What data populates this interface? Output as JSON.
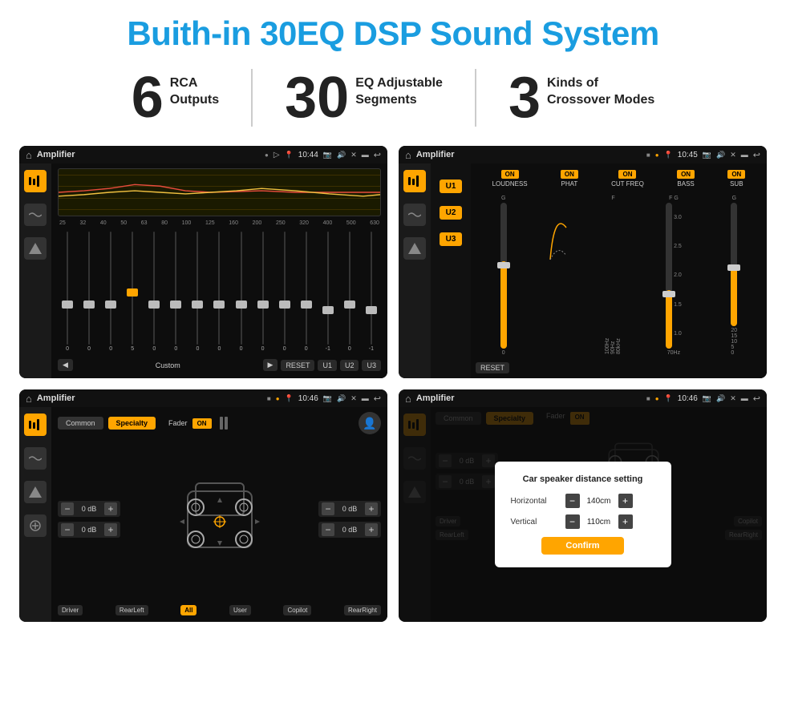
{
  "page": {
    "title": "Buith-in 30EQ DSP Sound System",
    "stats": [
      {
        "number": "6",
        "label1": "RCA",
        "label2": "Outputs"
      },
      {
        "number": "30",
        "label1": "EQ Adjustable",
        "label2": "Segments"
      },
      {
        "number": "3",
        "label1": "Kinds of",
        "label2": "Crossover Modes"
      }
    ]
  },
  "screens": [
    {
      "id": "eq-screen",
      "status": {
        "title": "Amplifier",
        "time": "10:44"
      },
      "type": "eq",
      "eq_freqs": [
        "25",
        "32",
        "40",
        "50",
        "63",
        "80",
        "100",
        "125",
        "160",
        "200",
        "250",
        "320",
        "400",
        "500",
        "630"
      ],
      "eq_values": [
        "0",
        "0",
        "0",
        "5",
        "0",
        "0",
        "0",
        "0",
        "0",
        "0",
        "0",
        "0",
        "-1",
        "0",
        "-1"
      ],
      "preset": "Custom",
      "buttons": [
        "RESET",
        "U1",
        "U2",
        "U3"
      ]
    },
    {
      "id": "crossover-screen",
      "status": {
        "title": "Amplifier",
        "time": "10:45"
      },
      "type": "crossover",
      "u_buttons": [
        "U1",
        "U2",
        "U3"
      ],
      "on_groups": [
        "LOUDNESS",
        "PHAT",
        "CUT FREQ",
        "BASS",
        "SUB"
      ],
      "reset_label": "RESET"
    },
    {
      "id": "fader-screen",
      "status": {
        "title": "Amplifier",
        "time": "10:46"
      },
      "type": "fader",
      "tabs": [
        "Common",
        "Specialty"
      ],
      "active_tab": "Specialty",
      "fader_label": "Fader",
      "on_label": "ON",
      "db_values": [
        "0 dB",
        "0 dB",
        "0 dB",
        "0 dB"
      ],
      "position_labels": [
        "Driver",
        "RearLeft",
        "All",
        "User",
        "Copilot",
        "RearRight"
      ]
    },
    {
      "id": "dialog-screen",
      "status": {
        "title": "Amplifier",
        "time": "10:46"
      },
      "type": "dialog",
      "dialog": {
        "title": "Car speaker distance setting",
        "horizontal_label": "Horizontal",
        "horizontal_value": "140cm",
        "vertical_label": "Vertical",
        "vertical_value": "110cm",
        "confirm_label": "Confirm"
      },
      "db_values": [
        "0 dB",
        "0 dB"
      ]
    }
  ]
}
